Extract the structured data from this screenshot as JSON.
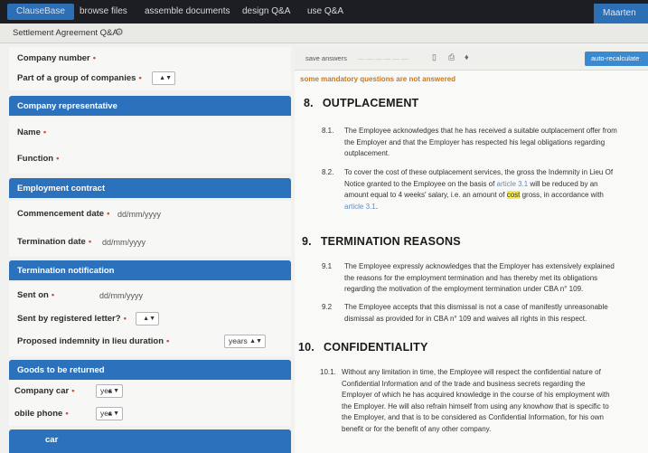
{
  "nav": {
    "brand": "ClauseBase",
    "links": [
      "browse files",
      "assemble documents",
      "design Q&A",
      "use Q&A"
    ],
    "user": "Maarten"
  },
  "subheader": {
    "doc_title": "Settlement Agreement Q&A"
  },
  "form": {
    "company_number_label": "Company number",
    "part_of_group_label": "Part of a group of companies",
    "sections": {
      "company_rep": "Company representative",
      "employment_contract": "Employment contract",
      "termination_notification": "Termination notification",
      "goods_returned": "Goods to be returned",
      "next_partial": "car"
    },
    "name_label": "Name",
    "function_label": "Function",
    "commencement_label": "Commencement date",
    "commencement_placeholder": "dd/mm/yyyy",
    "termination_label": "Termination date",
    "termination_placeholder": "dd/mm/yyyy",
    "sent_on_label": "Sent on",
    "sent_on_placeholder": "dd/mm/yyyy",
    "registered_label": "Sent by registered letter?",
    "indemnity_label": "Proposed indemnity in lieu duration",
    "indemnity_unit": "years",
    "company_car_label": "Company car",
    "company_car_value": "yes",
    "mobile_phone_label": "obile phone",
    "mobile_phone_value": "yes"
  },
  "doc": {
    "toolbar": {
      "save": "save answers",
      "auto": "auto-recalculate"
    },
    "warning": "some mandatory questions are not answered",
    "s8": {
      "num": "8.",
      "title": "OUTPLACEMENT",
      "c1_num": "8.1.",
      "c1_l1": "The Employee acknowledges that he has received a suitable outplacement offer from",
      "c1_l2": "the Employer and that the Employer has respected his legal obligations regarding",
      "c1_l3": "outplacement.",
      "c2_num": "8.2.",
      "c2_l1": "To cover the cost of these outplacement services, the gross the Indemnity in Lieu Of",
      "c2_l2a": "Notice granted to the Employee on the basis of ",
      "c2_link1": "article 3.1",
      "c2_l2b": " will be reduced by an",
      "c2_l3a": "amount equal to 4 weeks' salary, i.e. an amount of ",
      "c2_hl": "cost",
      "c2_l3b": " gross, in accordance with",
      "c2_link2": "article 3.1",
      "c2_end": "."
    },
    "s9": {
      "num": "9.",
      "title": "TERMINATION REASONS",
      "c1_num": "9.1",
      "c1_l1": "The Employee expressly acknowledges that the Employer has extensively explained",
      "c1_l2": "the reasons for the employment termination and has thereby met its obligations",
      "c1_l3": "regarding the motivation of the employment termination under CBA n° 109.",
      "c2_num": "9.2",
      "c2_l1": "The Employee accepts that this dismissal is not a case of manifestly unreasonable",
      "c2_l2": "dismissal as provided for in CBA n° 109 and waives all rights in this respect."
    },
    "s10": {
      "num": "10.",
      "title": "CONFIDENTIALITY",
      "c1_num": "10.1.",
      "c1_l1": "Without any limitation in time, the Employee will respect the confidential nature of",
      "c1_l2": "Confidential Information and of the trade and business secrets regarding the",
      "c1_l3": "Employer of which he has acquired knowledge in the course of his employment with",
      "c1_l4": "the Employer. He will also refrain himself from using any knowhow that is specific to",
      "c1_l5": "the Employer, and that is to be considered as Confidential Information, for his own",
      "c1_l6": "benefit or for the benefit of any other company."
    }
  }
}
